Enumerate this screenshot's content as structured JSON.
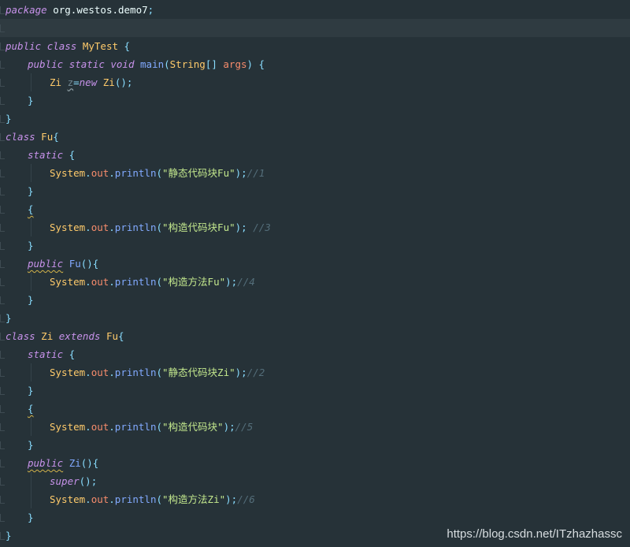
{
  "editor": {
    "theme_colors": {
      "background": "#263238",
      "current_line": "#2f3b41",
      "keyword": "#c792ea",
      "class_name": "#ffcb6b",
      "function": "#82aaff",
      "string": "#c3e88d",
      "comment": "#546e7a",
      "field": "#f78c6c",
      "plain": "#eeffff"
    },
    "lines": [
      {
        "indent": 0,
        "tokens": [
          {
            "t": "package",
            "c": "kw"
          },
          {
            "t": " org.westos.demo7",
            "c": "pl"
          },
          {
            "t": ";",
            "c": "pu"
          }
        ]
      },
      {
        "indent": 0,
        "current": true,
        "tokens": []
      },
      {
        "indent": 0,
        "tokens": [
          {
            "t": "public",
            "c": "kw"
          },
          {
            "t": " ",
            "c": "pl"
          },
          {
            "t": "class",
            "c": "kw"
          },
          {
            "t": " ",
            "c": "pl"
          },
          {
            "t": "MyTest",
            "c": "cls"
          },
          {
            "t": " {",
            "c": "pu"
          }
        ]
      },
      {
        "indent": 1,
        "tokens": [
          {
            "t": "public",
            "c": "kw"
          },
          {
            "t": " ",
            "c": "pl"
          },
          {
            "t": "static",
            "c": "kw"
          },
          {
            "t": " ",
            "c": "pl"
          },
          {
            "t": "void",
            "c": "kw"
          },
          {
            "t": " ",
            "c": "pl"
          },
          {
            "t": "main",
            "c": "fn"
          },
          {
            "t": "(",
            "c": "pu"
          },
          {
            "t": "String",
            "c": "cls"
          },
          {
            "t": "[] ",
            "c": "pu"
          },
          {
            "t": "args",
            "c": "var"
          },
          {
            "t": ") {",
            "c": "pu"
          }
        ]
      },
      {
        "indent": 2,
        "tokens": [
          {
            "t": "Zi",
            "c": "cls"
          },
          {
            "t": " ",
            "c": "pl"
          },
          {
            "t": "z",
            "c": "var-unused"
          },
          {
            "t": "=",
            "c": "pu"
          },
          {
            "t": "new",
            "c": "kw"
          },
          {
            "t": " ",
            "c": "pl"
          },
          {
            "t": "Zi",
            "c": "cls"
          },
          {
            "t": "();",
            "c": "pu"
          }
        ]
      },
      {
        "indent": 1,
        "tokens": [
          {
            "t": "}",
            "c": "pu"
          }
        ]
      },
      {
        "indent": 0,
        "tokens": [
          {
            "t": "}",
            "c": "pu"
          }
        ]
      },
      {
        "indent": 0,
        "tokens": [
          {
            "t": "class",
            "c": "kw"
          },
          {
            "t": " ",
            "c": "pl"
          },
          {
            "t": "Fu",
            "c": "cls"
          },
          {
            "t": "{",
            "c": "pu"
          }
        ]
      },
      {
        "indent": 1,
        "tokens": [
          {
            "t": "static",
            "c": "kw"
          },
          {
            "t": " {",
            "c": "pu"
          }
        ]
      },
      {
        "indent": 2,
        "tokens": [
          {
            "t": "System",
            "c": "cls"
          },
          {
            "t": ".",
            "c": "pu"
          },
          {
            "t": "out",
            "c": "fld"
          },
          {
            "t": ".",
            "c": "pu"
          },
          {
            "t": "println",
            "c": "fn"
          },
          {
            "t": "(",
            "c": "pu"
          },
          {
            "t": "\"静态代码块Fu\"",
            "c": "str"
          },
          {
            "t": ");",
            "c": "pu"
          },
          {
            "t": "//1",
            "c": "cm"
          }
        ]
      },
      {
        "indent": 1,
        "tokens": [
          {
            "t": "}",
            "c": "pu"
          }
        ]
      },
      {
        "indent": 1,
        "tokens": [
          {
            "t": "{",
            "c": "pu warn"
          }
        ]
      },
      {
        "indent": 2,
        "tokens": [
          {
            "t": "System",
            "c": "cls"
          },
          {
            "t": ".",
            "c": "pu"
          },
          {
            "t": "out",
            "c": "fld"
          },
          {
            "t": ".",
            "c": "pu"
          },
          {
            "t": "println",
            "c": "fn"
          },
          {
            "t": "(",
            "c": "pu"
          },
          {
            "t": "\"构造代码块Fu\"",
            "c": "str"
          },
          {
            "t": "); ",
            "c": "pu"
          },
          {
            "t": "//3",
            "c": "cm"
          }
        ]
      },
      {
        "indent": 1,
        "tokens": [
          {
            "t": "}",
            "c": "pu"
          }
        ]
      },
      {
        "indent": 1,
        "tokens": [
          {
            "t": "public",
            "c": "kw warn"
          },
          {
            "t": " ",
            "c": "pl"
          },
          {
            "t": "Fu",
            "c": "fn"
          },
          {
            "t": "(){",
            "c": "pu"
          }
        ]
      },
      {
        "indent": 2,
        "tokens": [
          {
            "t": "System",
            "c": "cls"
          },
          {
            "t": ".",
            "c": "pu"
          },
          {
            "t": "out",
            "c": "fld"
          },
          {
            "t": ".",
            "c": "pu"
          },
          {
            "t": "println",
            "c": "fn"
          },
          {
            "t": "(",
            "c": "pu"
          },
          {
            "t": "\"构造方法Fu\"",
            "c": "str"
          },
          {
            "t": ");",
            "c": "pu"
          },
          {
            "t": "//4",
            "c": "cm"
          }
        ]
      },
      {
        "indent": 1,
        "tokens": [
          {
            "t": "}",
            "c": "pu"
          }
        ]
      },
      {
        "indent": 0,
        "tokens": [
          {
            "t": "}",
            "c": "pu"
          }
        ]
      },
      {
        "indent": 0,
        "tokens": [
          {
            "t": "class",
            "c": "kw"
          },
          {
            "t": " ",
            "c": "pl"
          },
          {
            "t": "Zi",
            "c": "cls"
          },
          {
            "t": " ",
            "c": "pl"
          },
          {
            "t": "extends",
            "c": "kw"
          },
          {
            "t": " ",
            "c": "pl"
          },
          {
            "t": "Fu",
            "c": "cls"
          },
          {
            "t": "{",
            "c": "pu"
          }
        ]
      },
      {
        "indent": 1,
        "tokens": [
          {
            "t": "static",
            "c": "kw"
          },
          {
            "t": " {",
            "c": "pu"
          }
        ]
      },
      {
        "indent": 2,
        "tokens": [
          {
            "t": "System",
            "c": "cls"
          },
          {
            "t": ".",
            "c": "pu"
          },
          {
            "t": "out",
            "c": "fld"
          },
          {
            "t": ".",
            "c": "pu"
          },
          {
            "t": "println",
            "c": "fn"
          },
          {
            "t": "(",
            "c": "pu"
          },
          {
            "t": "\"静态代码块Zi\"",
            "c": "str"
          },
          {
            "t": ");",
            "c": "pu"
          },
          {
            "t": "//2",
            "c": "cm"
          }
        ]
      },
      {
        "indent": 1,
        "tokens": [
          {
            "t": "}",
            "c": "pu"
          }
        ]
      },
      {
        "indent": 1,
        "tokens": [
          {
            "t": "{",
            "c": "pu warn"
          }
        ]
      },
      {
        "indent": 2,
        "tokens": [
          {
            "t": "System",
            "c": "cls"
          },
          {
            "t": ".",
            "c": "pu"
          },
          {
            "t": "out",
            "c": "fld"
          },
          {
            "t": ".",
            "c": "pu"
          },
          {
            "t": "println",
            "c": "fn"
          },
          {
            "t": "(",
            "c": "pu"
          },
          {
            "t": "\"构造代码块\"",
            "c": "str"
          },
          {
            "t": ");",
            "c": "pu"
          },
          {
            "t": "//5",
            "c": "cm"
          }
        ]
      },
      {
        "indent": 1,
        "tokens": [
          {
            "t": "}",
            "c": "pu"
          }
        ]
      },
      {
        "indent": 1,
        "tokens": [
          {
            "t": "public",
            "c": "kw warn"
          },
          {
            "t": " ",
            "c": "pl"
          },
          {
            "t": "Zi",
            "c": "fn"
          },
          {
            "t": "(){",
            "c": "pu"
          }
        ]
      },
      {
        "indent": 2,
        "tokens": [
          {
            "t": "super",
            "c": "kw"
          },
          {
            "t": "();",
            "c": "pu"
          }
        ]
      },
      {
        "indent": 2,
        "tokens": [
          {
            "t": "System",
            "c": "cls"
          },
          {
            "t": ".",
            "c": "pu"
          },
          {
            "t": "out",
            "c": "fld"
          },
          {
            "t": ".",
            "c": "pu"
          },
          {
            "t": "println",
            "c": "fn"
          },
          {
            "t": "(",
            "c": "pu"
          },
          {
            "t": "\"构造方法Zi\"",
            "c": "str"
          },
          {
            "t": ");",
            "c": "pu"
          },
          {
            "t": "//6",
            "c": "cm"
          }
        ]
      },
      {
        "indent": 1,
        "tokens": [
          {
            "t": "}",
            "c": "pu"
          }
        ]
      },
      {
        "indent": 0,
        "tokens": [
          {
            "t": "}",
            "c": "pu"
          }
        ]
      }
    ]
  },
  "watermark": "https://blog.csdn.net/ITzhazhassc"
}
